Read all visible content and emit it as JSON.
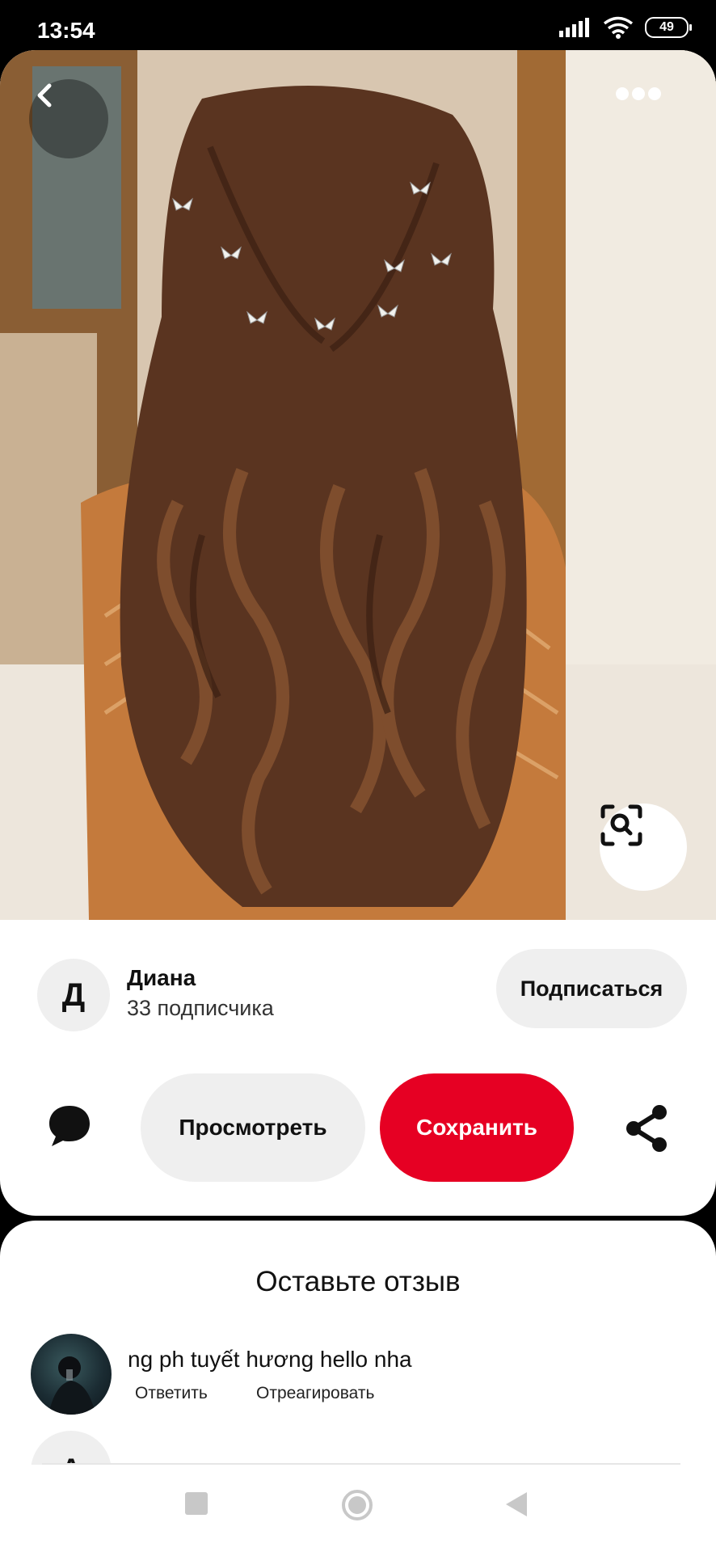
{
  "status_bar": {
    "time": "13:54",
    "battery": "49"
  },
  "pin": {
    "image_alt": "Long wavy brown hair with twisted half-up style and butterfly pins",
    "back_icon": "chevron-left-icon",
    "more_icon": "more-horizontal-icon",
    "lens_icon": "visual-search-icon"
  },
  "creator": {
    "initial": "Д",
    "name": "Диана",
    "followers": "33 подписчика",
    "subscribe_label": "Подписаться"
  },
  "actions": {
    "view_label": "Просмотреть",
    "save_label": "Сохранить",
    "chat_icon": "chat-bubble-icon",
    "share_icon": "share-icon",
    "save_color": "#e60023"
  },
  "comments": {
    "title": "Оставьте отзыв",
    "items": [
      {
        "text": "ng ph tuyết hương hello nha",
        "reply_label": "Ответить",
        "react_label": "Отреагировать"
      }
    ],
    "next_initial": "A"
  },
  "nav": {
    "recents_icon": "square-icon",
    "home_icon": "circle-home-icon",
    "back_icon": "triangle-back-icon"
  }
}
